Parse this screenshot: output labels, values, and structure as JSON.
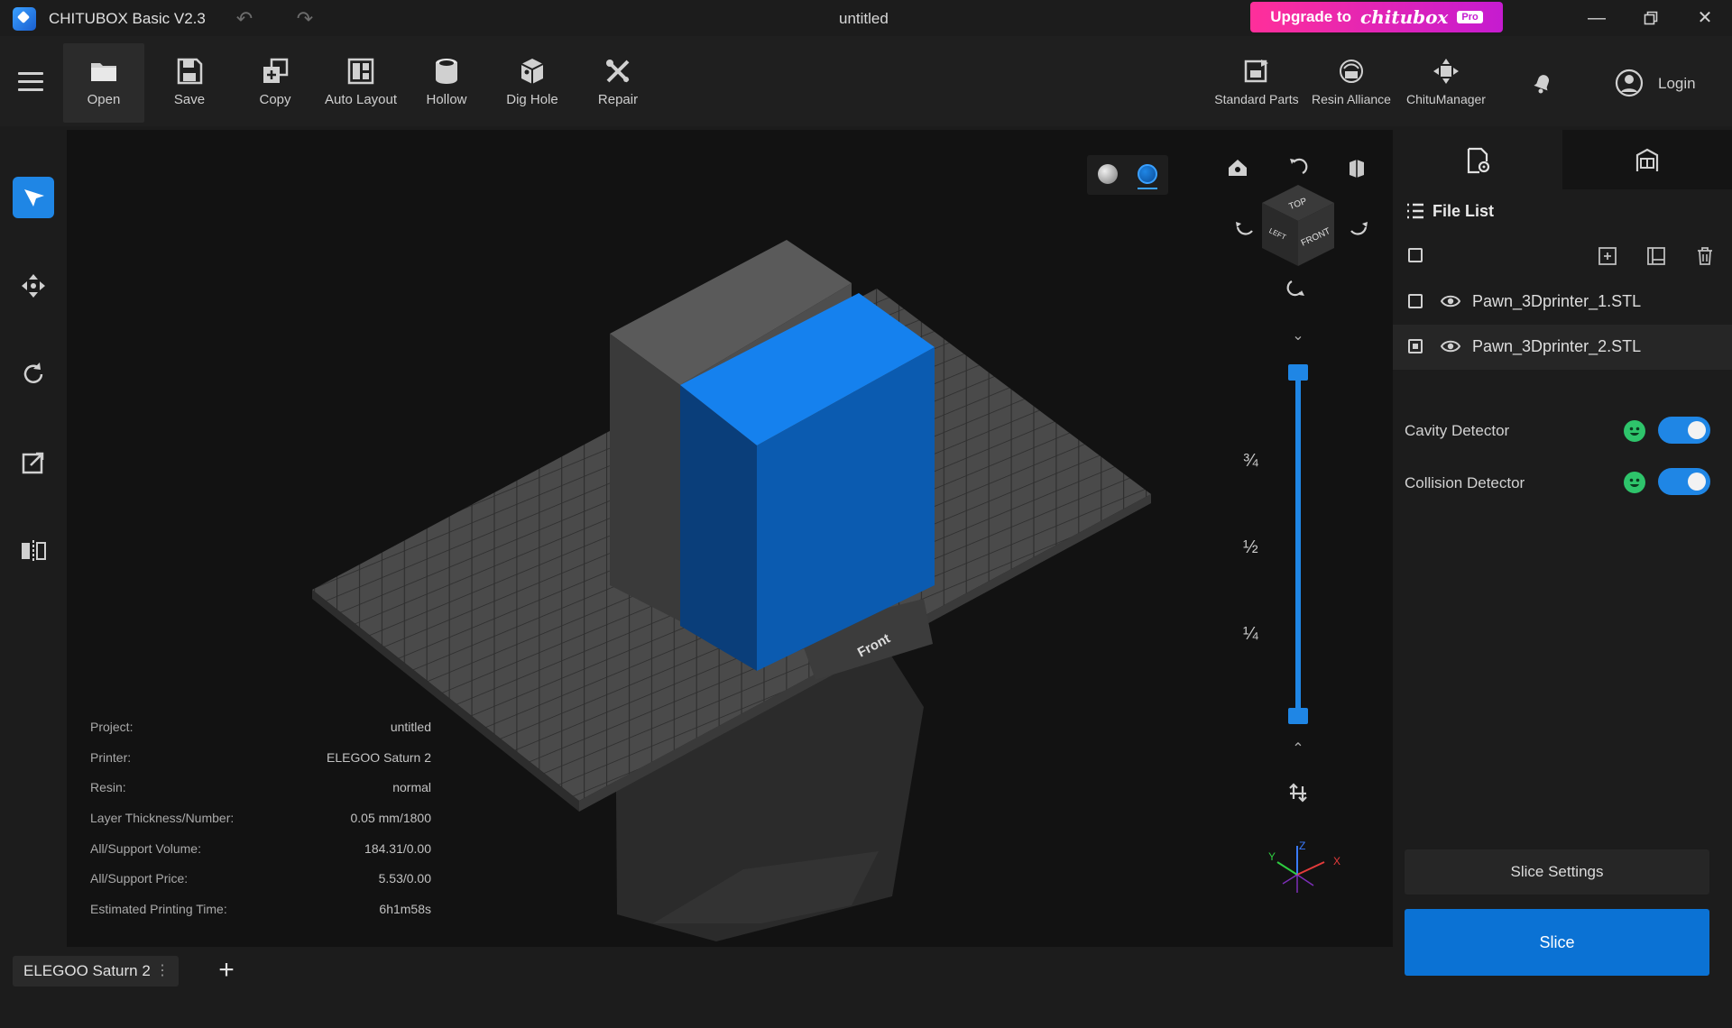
{
  "window": {
    "app_title": "CHITUBOX Basic V2.3",
    "document_title": "untitled",
    "upgrade": {
      "prefix": "Upgrade to",
      "brand": "chitubox",
      "badge": "Pro"
    }
  },
  "toolbar": {
    "tools": [
      {
        "label": "Open",
        "icon": "folder-icon"
      },
      {
        "label": "Save",
        "icon": "save-icon"
      },
      {
        "label": "Copy",
        "icon": "copy-icon"
      },
      {
        "label": "Auto Layout",
        "icon": "auto-layout-icon"
      },
      {
        "label": "Hollow",
        "icon": "hollow-icon"
      },
      {
        "label": "Dig Hole",
        "icon": "dig-hole-icon"
      },
      {
        "label": "Repair",
        "icon": "repair-icon"
      }
    ],
    "right_tools": [
      {
        "label": "Standard Parts",
        "icon": "standard-parts-icon"
      },
      {
        "label": "Resin Alliance",
        "icon": "resin-alliance-icon"
      },
      {
        "label": "ChituManager",
        "icon": "chitumanager-icon"
      }
    ],
    "login_label": "Login"
  },
  "viewport": {
    "layer_slider": {
      "fractions": [
        "¾",
        "½",
        "¼"
      ]
    },
    "view_cube": {
      "top": "TOP",
      "front": "FRONT",
      "left": "LEFT"
    },
    "plate_label": "Front",
    "axes": {
      "x": "X",
      "y": "Y",
      "z": "Z"
    },
    "colors": {
      "model": "#0e6fd6",
      "plate": "#444444",
      "accent": "#1f86e5"
    }
  },
  "info": [
    {
      "label": "Project:",
      "value": "untitled"
    },
    {
      "label": "Printer:",
      "value": "ELEGOO Saturn 2"
    },
    {
      "label": "Resin:",
      "value": "normal"
    },
    {
      "label": "Layer Thickness/Number:",
      "value": "0.05 mm/1800"
    },
    {
      "label": "All/Support Volume:",
      "value": "184.31/0.00"
    },
    {
      "label": "All/Support Price:",
      "value": "5.53/0.00"
    },
    {
      "label": "Estimated Printing Time:",
      "value": "6h1m58s"
    }
  ],
  "panel": {
    "file_list_title": "File List",
    "files": [
      {
        "name": "Pawn_3Dprinter_1.STL",
        "selected": false
      },
      {
        "name": "Pawn_3Dprinter_2.STL",
        "selected": true
      }
    ],
    "detectors": [
      {
        "label": "Cavity Detector",
        "on": true
      },
      {
        "label": "Collision Detector",
        "on": true
      }
    ],
    "slice_settings_label": "Slice Settings",
    "slice_label": "Slice"
  },
  "bottom": {
    "printer_tab": "ELEGOO Saturn 2",
    "more": "⋮",
    "add": "+"
  }
}
